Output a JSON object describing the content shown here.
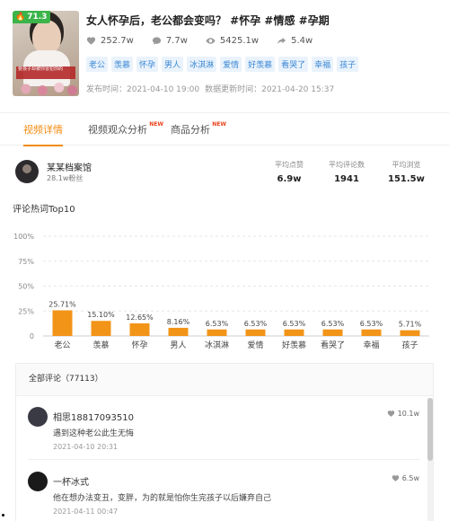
{
  "video": {
    "score": "71.3",
    "thumb_caption": "要孩子却被你冒犯你的",
    "title": "女人怀孕后，老公都会变吗？ #怀孕 #情感 #孕期",
    "stats": [
      {
        "icon": "heart-icon",
        "value": "252.7w"
      },
      {
        "icon": "comment-icon",
        "value": "7.7w"
      },
      {
        "icon": "eye-icon",
        "value": "5425.1w"
      },
      {
        "icon": "share-icon",
        "value": "5.4w"
      }
    ],
    "tags": [
      "老公",
      "羡慕",
      "怀孕",
      "男人",
      "冰淇淋",
      "爱情",
      "好羡慕",
      "看哭了",
      "幸福",
      "孩子"
    ],
    "publish_time": "发布时间：2021-04-10 19:00",
    "update_time": "数据更新时间：2021-04-20 15:37"
  },
  "tabs": [
    {
      "label": "视频详情",
      "new": "",
      "active": true
    },
    {
      "label": "视频观众分析",
      "new": "NEW",
      "active": false
    },
    {
      "label": "商品分析",
      "new": "NEW",
      "active": false
    }
  ],
  "author": {
    "name": "某某档案馆",
    "fans": "28.1w粉丝"
  },
  "averages": [
    {
      "label": "平均点赞",
      "value": "6.9w"
    },
    {
      "label": "平均评论数",
      "value": "1941"
    },
    {
      "label": "平均浏览",
      "value": "151.5w"
    }
  ],
  "chart_title": "评论热词Top10",
  "chart_data": {
    "type": "bar",
    "title": "评论热词Top10",
    "categories": [
      "老公",
      "羡慕",
      "怀孕",
      "男人",
      "冰淇淋",
      "爱情",
      "好羡慕",
      "看哭了",
      "幸福",
      "孩子"
    ],
    "values": [
      25.71,
      15.1,
      12.65,
      8.16,
      6.53,
      6.53,
      6.53,
      6.53,
      6.53,
      5.71
    ],
    "value_labels": [
      "25.71%",
      "15.10%",
      "12.65%",
      "8.16%",
      "6.53%",
      "6.53%",
      "6.53%",
      "6.53%",
      "6.53%",
      "5.71%"
    ],
    "yticks": [
      "0",
      "25%",
      "50%",
      "75%",
      "100%"
    ],
    "ylim": [
      0,
      100
    ],
    "grid": true,
    "bar_color": "#f29418"
  },
  "comments": {
    "header": "全部评论（77113）",
    "items": [
      {
        "user": "相思18817093510",
        "text": "遇到这种老公此生无悔",
        "time": "2021-04-10 20:31",
        "likes": "10.1w"
      },
      {
        "user": "一杯冰式",
        "text": "他在想办法变丑，变胖，为的就是怕你生完孩子以后嫌弃自己",
        "time": "2021-04-11 00:47",
        "likes": "6.5w"
      }
    ]
  },
  "colors": {
    "accent": "#f28b12",
    "score_badge": "#3bb449",
    "tag_bg": "#eaf3fc",
    "tag_text": "#3a87d4",
    "new_badge": "#e8421a"
  }
}
